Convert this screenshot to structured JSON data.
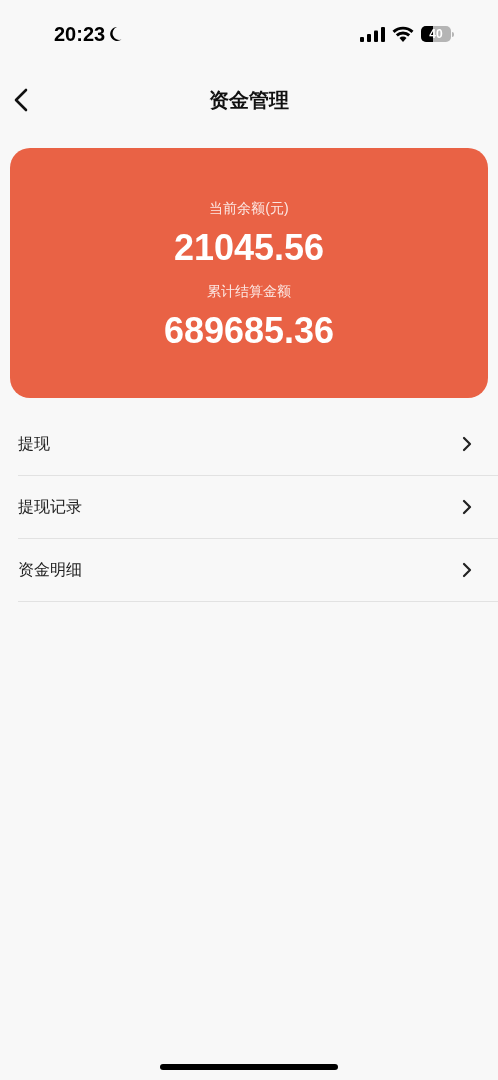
{
  "status_bar": {
    "time": "20:23",
    "battery": "40"
  },
  "nav": {
    "title": "资金管理"
  },
  "summary": [
    {
      "label": "当前余额(元)",
      "value": "21045.56"
    },
    {
      "label": "累计结算金额",
      "value": "689685.36"
    }
  ],
  "menu": [
    {
      "label": "提现"
    },
    {
      "label": "提现记录"
    },
    {
      "label": "资金明细"
    }
  ]
}
